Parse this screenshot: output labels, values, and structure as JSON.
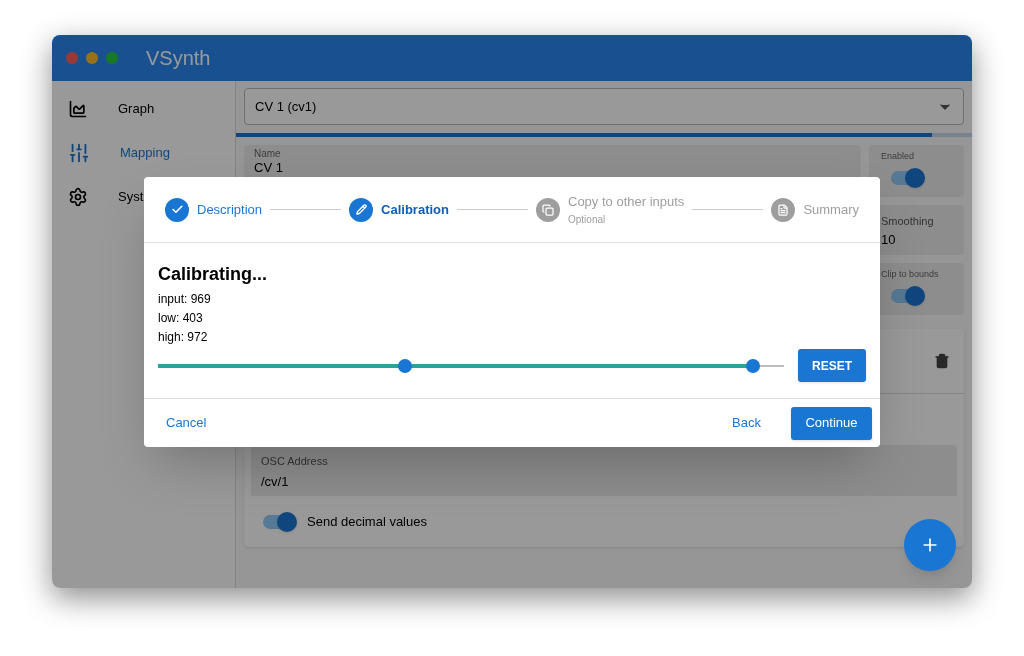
{
  "window": {
    "title": "VSynth"
  },
  "sidebar": {
    "items": [
      {
        "label": "Graph",
        "kind": "graph",
        "selected": false
      },
      {
        "label": "Mapping",
        "kind": "mapping",
        "selected": true
      },
      {
        "label": "Syst",
        "kind": "settings",
        "selected": false
      }
    ]
  },
  "input_select": {
    "value": "CV 1 (cv1)"
  },
  "progress": {
    "level": 0.946
  },
  "name_field": {
    "label": "Name",
    "value": "CV 1"
  },
  "enabled": {
    "label": "Enabled",
    "on": true
  },
  "smoothing": {
    "label": "Smoothing",
    "value": "10"
  },
  "clip": {
    "label": "Clip to bounds",
    "on": true
  },
  "osc_field": {
    "label": "OSC Address",
    "value": "/cv/1"
  },
  "send_decimal": {
    "label": "Send decimal values",
    "on": true
  },
  "dialog": {
    "steps": [
      {
        "label": "Description",
        "kind": "description",
        "completed": true,
        "selected": false
      },
      {
        "label": "Calibration",
        "kind": "calibration",
        "completed": false,
        "selected": true
      },
      {
        "label": "Copy to other inputs",
        "sublabel": "Optional",
        "kind": "copy",
        "completed": false,
        "selected": false
      },
      {
        "label": "Summary",
        "kind": "summary",
        "completed": false,
        "selected": false
      }
    ],
    "heading": "Calibrating...",
    "readings": [
      "input: 969",
      "low: 403",
      "high: 972"
    ],
    "slider": {
      "fill": {
        "level": 0.947
      },
      "thumbs": [
        {
          "level": 0.394
        },
        {
          "level": 0.95
        }
      ]
    },
    "reset_button": "RESET",
    "cancel_button": "Cancel",
    "back_button": "Back",
    "continue_button": "Continue"
  }
}
